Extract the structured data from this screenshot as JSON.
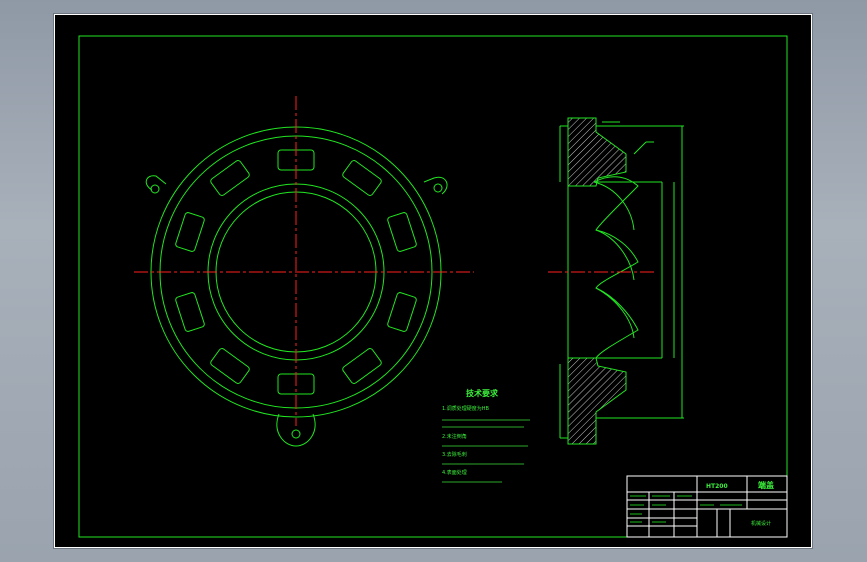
{
  "colors": {
    "line": "#22e522",
    "center": "#ff2020",
    "white": "#ffffff",
    "hatch": "#c9c9c9",
    "background": "#000000"
  },
  "notes": {
    "title": "技术要求",
    "items": [
      "1.调质处理硬度为HB",
      "2.未注倒角",
      "3.去除毛刺",
      "4.表面处理"
    ]
  },
  "title_block": {
    "drawing_no": "HT200",
    "name": "端盖",
    "material": "HT200",
    "school": "机械设计"
  }
}
